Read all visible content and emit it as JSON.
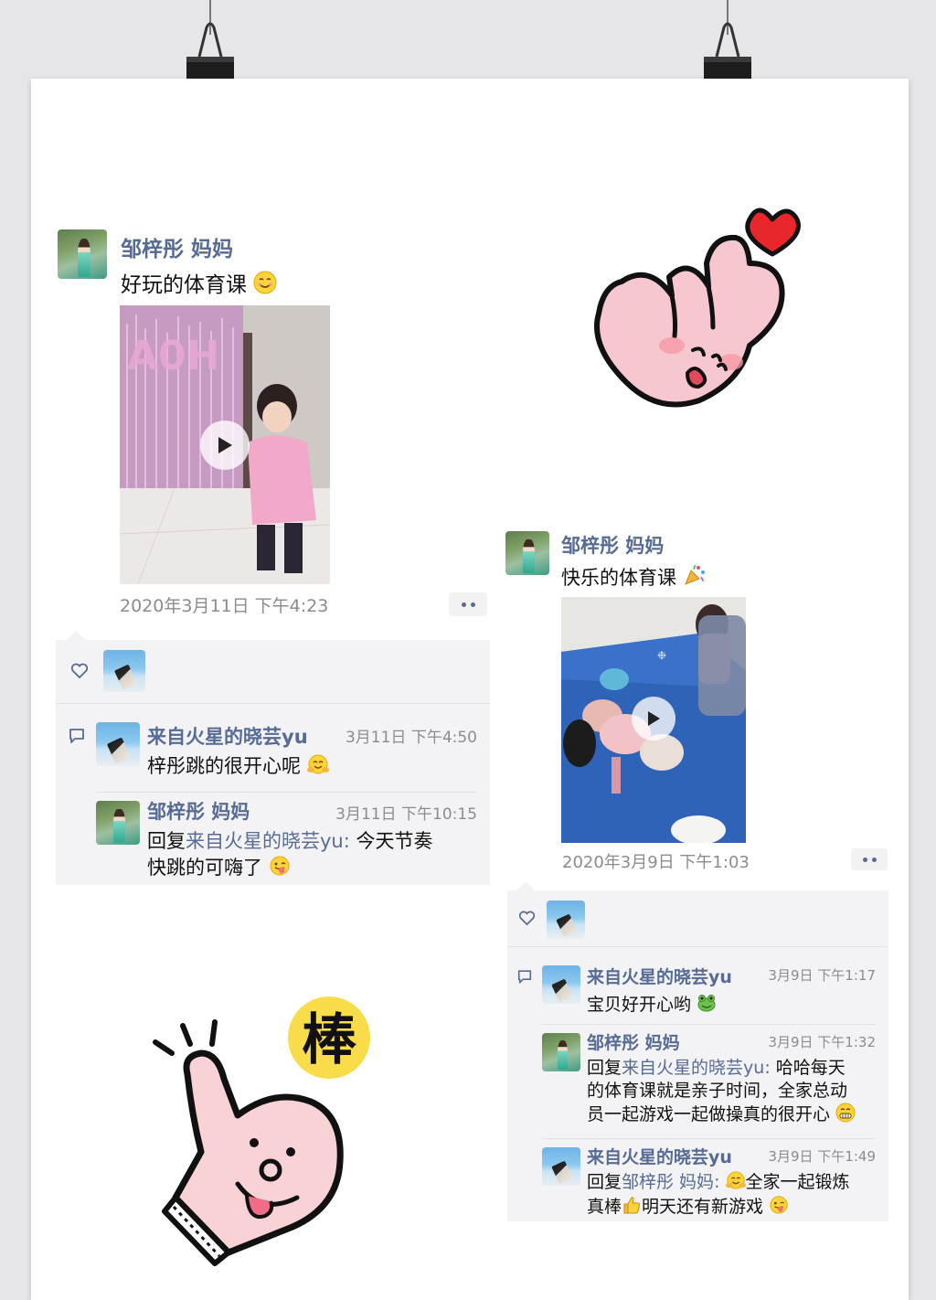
{
  "post1": {
    "author": "邹梓彤 妈妈",
    "caption": "好玩的体育课",
    "caption_emoji": "smiling-face-emoji",
    "timestamp": "2020年3月11日 下午4:23",
    "likes_icon": "heart-outline-icon",
    "comments": [
      {
        "author": "来自火星的晓芸yu",
        "time": "3月11日 下午4:50",
        "text": "梓彤跳的很开心呢",
        "emoji": "hugging-face-emoji"
      },
      {
        "author": "邹梓彤 妈妈",
        "time": "3月11日 下午10:15",
        "reply_prefix": "回复",
        "reply_to": "来自火星的晓芸yu",
        "reply_sep": ": ",
        "text_line1": "今天节奏",
        "text_line2": "快跳的可嗨了",
        "emoji": "winking-tongue-emoji"
      }
    ]
  },
  "post2": {
    "author": "邹梓彤 妈妈",
    "caption": "快乐的体育课",
    "caption_emoji": "party-popper-emoji",
    "timestamp": "2020年3月9日 下午1:03",
    "comments": [
      {
        "author": "来自火星的晓芸yu",
        "time": "3月9日 下午1:17",
        "text": "宝贝好开心哟",
        "emoji": "frog-emoji"
      },
      {
        "author": "邹梓彤 妈妈",
        "time": "3月9日 下午1:32",
        "reply_prefix": "回复",
        "reply_to": "来自火星的晓芸yu",
        "reply_sep": ": ",
        "text_line1": "哈哈每天",
        "text_line2": "的体育课就是亲子时间，全家总动",
        "text_line3": "员一起游戏一起做操真的很开心",
        "emoji": "grinning-face-emoji"
      },
      {
        "author": "来自火星的晓芸yu",
        "time": "3月9日 下午1:49",
        "reply_prefix": "回复",
        "reply_to": "邹梓彤 妈妈",
        "reply_sep": ": ",
        "text_line1": "全家一起锻炼",
        "text_line2_a": "真棒",
        "text_line2_b": "明天还有新游戏",
        "emoji": "winking-tongue-emoji"
      }
    ]
  },
  "stickers": {
    "top_right": "finger-heart-sticker",
    "bottom_left": "thumbs-up-sticker",
    "bottom_left_label": "棒"
  },
  "colors": {
    "link_blue": "#576b95",
    "panel_bg": "#f3f3f5",
    "timestamp_gray": "#8c8c8c"
  }
}
